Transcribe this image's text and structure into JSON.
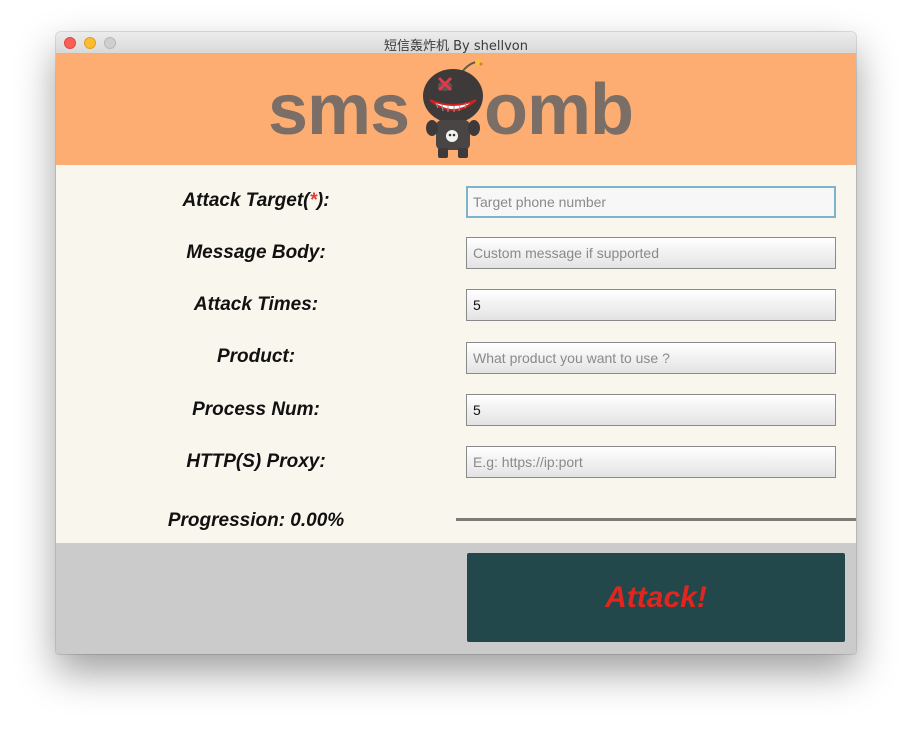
{
  "window": {
    "title": "短信轰炸机 By shellvon"
  },
  "banner": {
    "logo_left": "sms",
    "logo_right": "omb"
  },
  "form": {
    "target": {
      "label_prefix": "Attack Target(",
      "required_mark": "*",
      "label_suffix": "):",
      "placeholder": "Target phone number",
      "value": ""
    },
    "message": {
      "label": "Message Body:",
      "placeholder": "Custom message if supported",
      "value": ""
    },
    "times": {
      "label": "Attack Times:",
      "placeholder": "",
      "value": "5"
    },
    "product": {
      "label": "Product:",
      "placeholder": "What product you want to use ?",
      "value": ""
    },
    "process": {
      "label": "Process Num:",
      "placeholder": "",
      "value": "5"
    },
    "proxy": {
      "label": "HTTP(S) Proxy:",
      "placeholder": "E.g: https://ip:port",
      "value": ""
    }
  },
  "progress": {
    "label": "Progression: 0.00%",
    "fraction": 0.0
  },
  "footer": {
    "attack_label": "Attack!"
  },
  "colors": {
    "banner": "#fead72",
    "button_bg": "#22484b",
    "button_text": "#e0261f",
    "required": "#e53935"
  }
}
